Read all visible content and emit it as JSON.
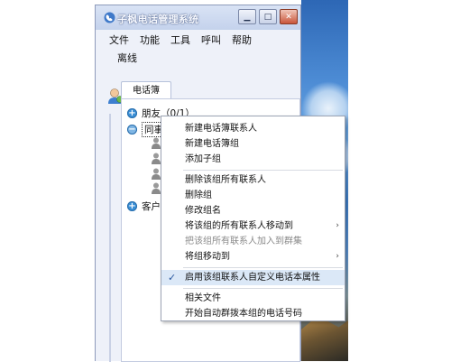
{
  "window": {
    "title": "子枫电话管理系统",
    "icon": "app-phone-icon",
    "buttons": [
      "minimize",
      "maximize",
      "close"
    ]
  },
  "menubar": {
    "items": [
      "文件",
      "功能",
      "工具",
      "呼叫",
      "帮助"
    ]
  },
  "status": {
    "text": "离线"
  },
  "panel": {
    "tab_label": "电话簿"
  },
  "tree": {
    "groups": [
      {
        "label": "朋友（0/1）",
        "expanded": false
      },
      {
        "label": "同事",
        "expanded": true
      },
      {
        "label": "客户",
        "expanded": false
      }
    ]
  },
  "context_menu": {
    "items": [
      {
        "label": "新建电话簿联系人"
      },
      {
        "label": "新建电话簿组"
      },
      {
        "label": "添加子组"
      },
      {
        "label": "删除该组所有联系人"
      },
      {
        "label": "删除组"
      },
      {
        "label": "修改组名"
      },
      {
        "label": "将该组的所有联系人移动到",
        "submenu": true
      },
      {
        "label": "把该组所有联系人加入到群集",
        "disabled": true
      },
      {
        "label": "将组移动到",
        "submenu": true
      },
      {
        "label": "启用该组联系人自定义电话本属性",
        "checked": true
      },
      {
        "label": "相关文件"
      },
      {
        "label": "开始自动群拨本组的电话号码"
      }
    ],
    "submenu_arrow": "›",
    "check_mark": "✓"
  }
}
